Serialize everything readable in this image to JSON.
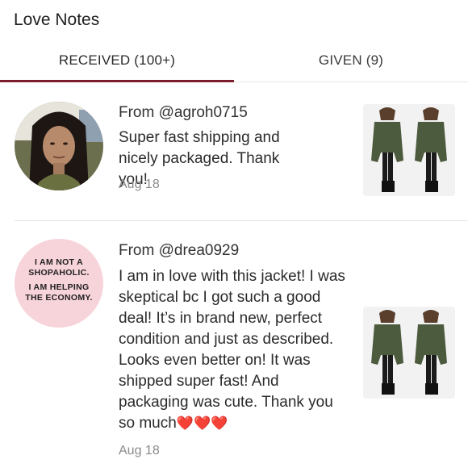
{
  "header": {
    "title": "Love Notes"
  },
  "tabs": [
    {
      "label": "RECEIVED (100+)",
      "active": true
    },
    {
      "label": "GIVEN (9)",
      "active": false
    }
  ],
  "colors": {
    "accent": "#7b1f2e",
    "heart": "#e02020",
    "muted": "#8a8a8a"
  },
  "notes": [
    {
      "from": "From @agroh0715",
      "message": "Super fast shipping and nicely packaged. Thank you!",
      "date": "Aug 18",
      "avatar_icon": "user-photo"
    },
    {
      "from": "From @drea0929",
      "message": "I am in love with this jacket! I was skeptical bc I got such a good deal! It’s in brand new, perfect condition and just as described. Looks even better on! It was shipped super fast! And packaging was cute. Thank you so much",
      "hearts": "❤️❤️❤️",
      "date": "Aug 18",
      "avatar_sign": {
        "line1": "I AM NOT A",
        "line2": "SHOPAHOLIC.",
        "line3": "I AM HELPING",
        "line4": "THE ECONOMY."
      }
    }
  ]
}
